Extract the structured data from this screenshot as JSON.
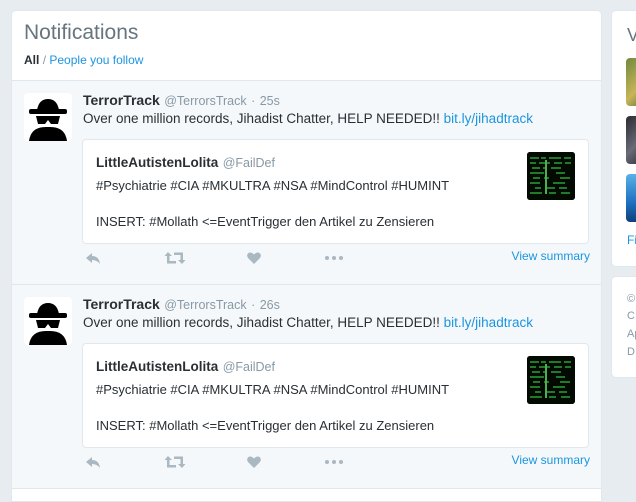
{
  "header": {
    "title": "Notifications",
    "filter_all": "All",
    "filter_sep": "/",
    "filter_follow": "People you follow"
  },
  "tweets": [
    {
      "name": "TerrorTrack",
      "handle": "@TerrorsTrack",
      "dot": "·",
      "time": "25s",
      "text": "Over one million records, Jihadist Chatter, HELP NEEDED!!",
      "link": "bit.ly/jihadtrack",
      "quote": {
        "name": "LittleAutistenLolita",
        "handle": "@FailDef",
        "line1": "#Psychiatrie #CIA #MKULTRA #NSA #MindControl #HUMINT",
        "line2": "INSERT: #Mollath <=EventTrigger den Artikel zu Zensieren"
      },
      "view_summary": "View summary"
    },
    {
      "name": "TerrorTrack",
      "handle": "@TerrorsTrack",
      "dot": "·",
      "time": "26s",
      "text": "Over one million records, Jihadist Chatter, HELP NEEDED!!",
      "link": "bit.ly/jihadtrack",
      "quote": {
        "name": "LittleAutistenLolita",
        "handle": "@FailDef",
        "line1": "#Psychiatrie #CIA #MKULTRA #NSA #MindControl #HUMINT",
        "line2": "INSERT: #Mollath <=EventTrigger den Artikel zu Zensieren"
      },
      "view_summary": "View summary"
    }
  ],
  "sidebar": {
    "title_fragment": "V",
    "link_fragment": "Fi",
    "footer_lines": [
      "©",
      "C",
      "Ap",
      "D"
    ]
  },
  "icons": {
    "reply": "reply-icon",
    "retweet": "retweet-icon",
    "like": "heart-icon",
    "more": "more-icon"
  },
  "colors": {
    "link": "#1b95e0",
    "background": "#e6ecf0",
    "muted": "#8899a6",
    "action_icon": "#aab8c2"
  }
}
